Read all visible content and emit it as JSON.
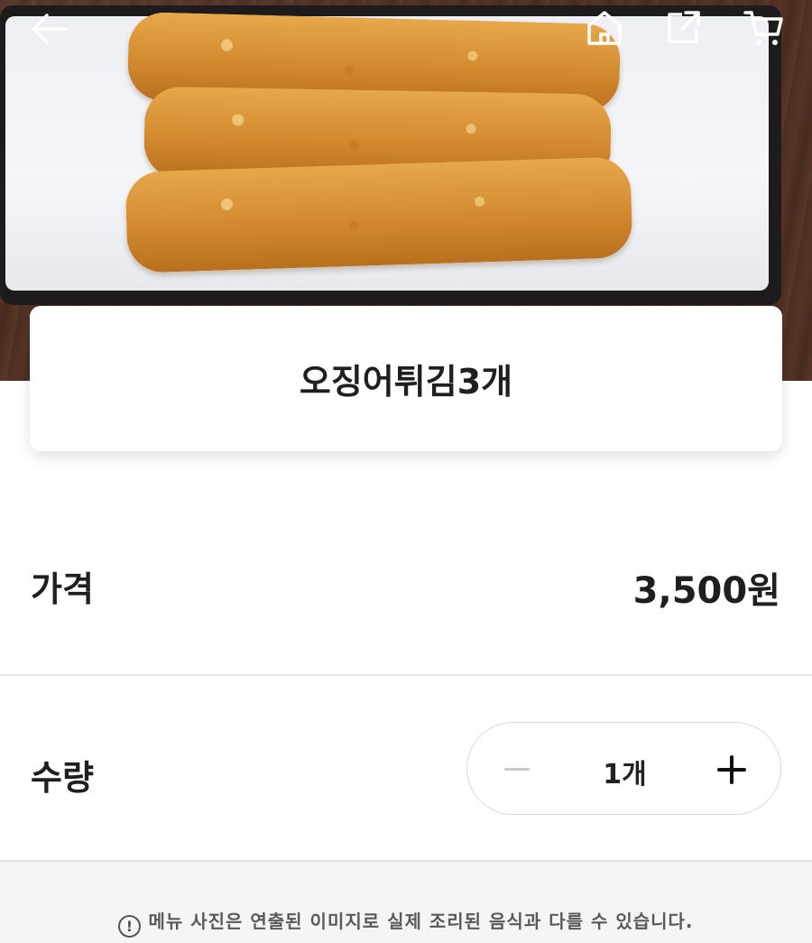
{
  "product": {
    "name": "오징어튀김3개"
  },
  "price": {
    "label": "가격",
    "value": "3,500원"
  },
  "quantity": {
    "label": "수량",
    "value": "1개"
  },
  "notice": {
    "icon": "!",
    "text": "메뉴 사진은 연출된 이미지로 실제 조리된 음식과 다를 수 있습니다."
  },
  "icons": {
    "back": "arrow-left-icon",
    "home": "home-icon",
    "share": "external-share-icon",
    "cart": "cart-icon"
  },
  "colors": {
    "text": "#1f1f1f",
    "divider": "#e4e4e4",
    "notice_bg": "#f5f5f5"
  }
}
